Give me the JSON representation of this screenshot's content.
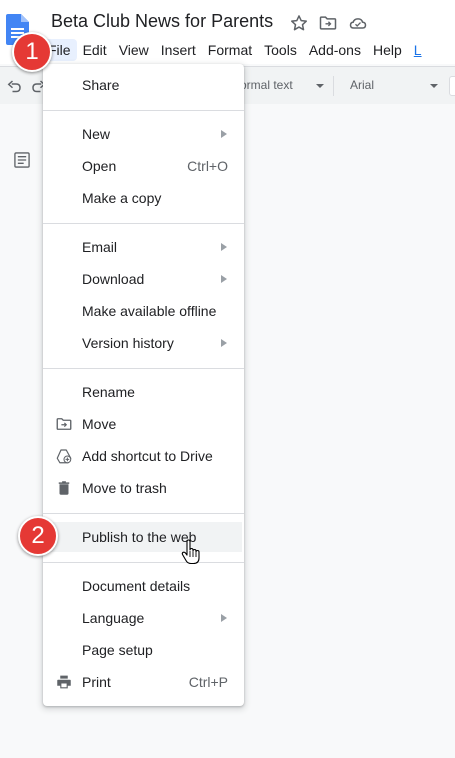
{
  "document": {
    "title": "Beta Club News for Parents"
  },
  "menubar": {
    "items": [
      {
        "label": "File",
        "active": true
      },
      {
        "label": "Edit"
      },
      {
        "label": "View"
      },
      {
        "label": "Insert"
      },
      {
        "label": "Format"
      },
      {
        "label": "Tools"
      },
      {
        "label": "Add-ons"
      },
      {
        "label": "Help"
      },
      {
        "label": "L",
        "link": true
      }
    ]
  },
  "toolbar": {
    "style_value": "ormal text",
    "font_value": "Arial"
  },
  "file_menu": {
    "items": [
      {
        "id": "share",
        "label": "Share"
      },
      {
        "id": "new",
        "label": "New",
        "submenu": true
      },
      {
        "id": "open",
        "label": "Open",
        "shortcut": "Ctrl+O"
      },
      {
        "id": "make-copy",
        "label": "Make a copy"
      },
      {
        "id": "email",
        "label": "Email",
        "submenu": true
      },
      {
        "id": "download",
        "label": "Download",
        "submenu": true
      },
      {
        "id": "offline",
        "label": "Make available offline"
      },
      {
        "id": "version-history",
        "label": "Version history",
        "submenu": true
      },
      {
        "id": "rename",
        "label": "Rename"
      },
      {
        "id": "move",
        "label": "Move",
        "icon": "folder-move-icon"
      },
      {
        "id": "add-shortcut",
        "label": "Add shortcut to Drive",
        "icon": "drive-shortcut-icon"
      },
      {
        "id": "trash",
        "label": "Move to trash",
        "icon": "trash-icon"
      },
      {
        "id": "publish",
        "label": "Publish to the web",
        "hovered": true
      },
      {
        "id": "details",
        "label": "Document details"
      },
      {
        "id": "language",
        "label": "Language",
        "submenu": true
      },
      {
        "id": "page-setup",
        "label": "Page setup"
      },
      {
        "id": "print",
        "label": "Print",
        "shortcut": "Ctrl+P",
        "icon": "print-icon"
      }
    ]
  },
  "callouts": {
    "step1": "1",
    "step2": "2"
  },
  "colors": {
    "callout": "#e53935",
    "menu_hover": "#f1f3f4",
    "active_menu": "#e8f0fe",
    "docs_blue": "#4285f4"
  }
}
